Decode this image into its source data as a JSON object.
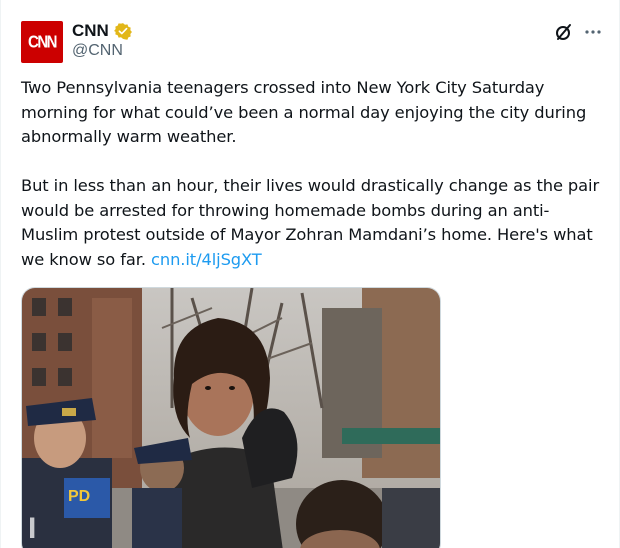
{
  "tweet": {
    "author": {
      "avatar_text": "CNN",
      "display_name": "CNN",
      "handle": "@CNN",
      "verified_color": "#e2b719"
    },
    "paragraph_1": "Two Pennsylvania teenagers crossed into New York City Saturday morning for what could’ve been a normal day enjoying the city during abnormally warm weather.",
    "paragraph_2_text": "But in less than an hour, their lives would drastically change as the pair would be arrested for throwing homemade bombs during an anti-Muslim protest outside of Mayor Zohran Mamdani’s home. Here's what we know so far. ",
    "paragraph_2_link": "cnn.it/4ljSgXT",
    "icons": {
      "grok": "grok-slash-icon",
      "more": "more-dots-icon"
    },
    "media": {
      "police_badge_text": "PD"
    }
  },
  "colors": {
    "brand": "#cc0000",
    "link": "#1d9bf0",
    "text": "#0f1419",
    "secondary": "#536471"
  }
}
